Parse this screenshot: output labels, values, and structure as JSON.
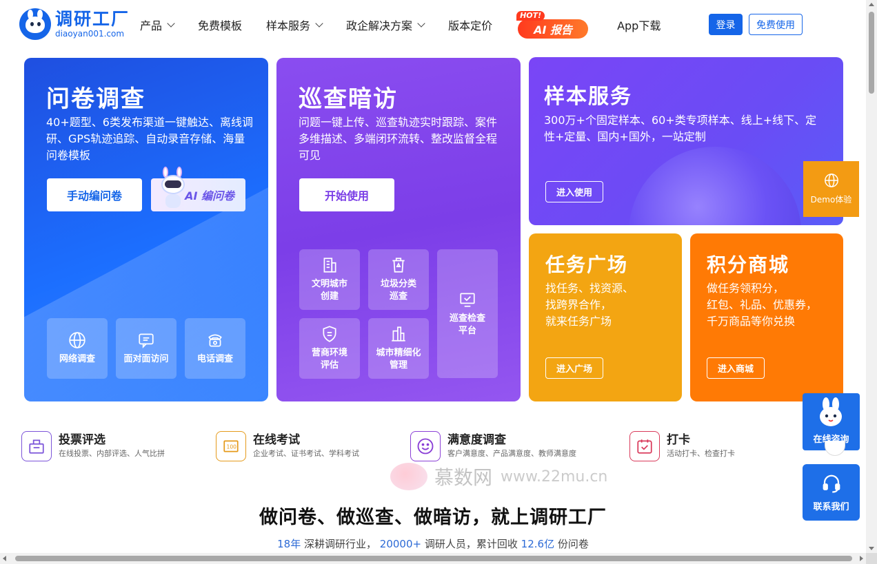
{
  "header": {
    "logo_title": "调研工厂",
    "logo_subtitle": "diaoyan001.com",
    "nav": [
      {
        "label": "产品",
        "has_dropdown": true
      },
      {
        "label": "免费模板",
        "has_dropdown": false
      },
      {
        "label": "样本服务",
        "has_dropdown": true
      },
      {
        "label": "政企解决方案",
        "has_dropdown": true
      },
      {
        "label": "版本定价",
        "has_dropdown": false
      }
    ],
    "ai_report_label": "AI 报告",
    "ai_report_badge": "HOT!",
    "app_download": "App下载",
    "login": "登录",
    "free_use": "免费使用"
  },
  "survey_card": {
    "title": "问卷调查",
    "desc": "40+题型、6类发布渠道一键触达、离线调研、GPS轨迹追踪、自动录音存储、海量问卷模板",
    "btn_manual": "手动编问卷",
    "btn_ai": "AI 编问卷",
    "tiles": [
      {
        "label": "网络调查",
        "icon": "globe-icon"
      },
      {
        "label": "面对面访问",
        "icon": "chat-icon"
      },
      {
        "label": "电话调查",
        "icon": "phone-icon"
      }
    ]
  },
  "inspection_card": {
    "title": "巡查暗访",
    "desc": "问题一键上传、巡查轨迹实时跟踪、案件多维描述、多端闭环流转、整改监督全程可见",
    "btn_start": "开始使用",
    "tiles": [
      {
        "label1": "文明城市",
        "label2": "创建",
        "icon": "building-icon"
      },
      {
        "label1": "垃圾分类",
        "label2": "巡查",
        "icon": "recycle-bin-icon"
      },
      {
        "label1": "巡查检查",
        "label2": "平台",
        "icon": "monitor-check-icon"
      },
      {
        "label1": "营商环境",
        "label2": "评估",
        "icon": "shield-icon"
      },
      {
        "label1": "城市精细化",
        "label2": "管理",
        "icon": "tower-icon"
      }
    ]
  },
  "sample_card": {
    "title": "样本服务",
    "desc": "300万+个固定样本、60+类专项样本、线上+线下、定性+定量、国内+国外，一站定制",
    "btn": "进入使用"
  },
  "task_card": {
    "title": "任务广场",
    "desc_lines": [
      "找任务、找资源、",
      "找跨界合作，",
      "就来任务广场"
    ],
    "btn": "进入广场",
    "color": "#f3a512"
  },
  "points_card": {
    "title": "积分商城",
    "desc_lines": [
      "做任务领积分，",
      "红包、礼品、优惠券，",
      "千万商品等你兑换"
    ],
    "btn": "进入商城",
    "color": "#ff7a05"
  },
  "features": [
    {
      "title": "投票评选",
      "sub": "在线投票、内部评选、人气比拼",
      "icon": "ballot-box-icon",
      "color": "#7b53d9"
    },
    {
      "title": "在线考试",
      "sub": "企业考试、证书考试、学科考试",
      "icon": "exam-paper-icon",
      "color": "#e59a1a"
    },
    {
      "title": "满意度调查",
      "sub": "客户满意度、产品满意度、教师满意度",
      "icon": "smile-icon",
      "color": "#8a3fd6"
    },
    {
      "title": "打卡",
      "sub": "活动打卡、检查打卡",
      "icon": "calendar-check-icon",
      "color": "#d9395a"
    }
  ],
  "watermark": {
    "name": "慕数网",
    "url": "www.22mu.cn"
  },
  "headline": "做问卷、做巡查、做暗访，就上调研工厂",
  "stats": {
    "n1": "18年",
    "t1": "深耕调研行业，",
    "n2": "20000+",
    "t2": "调研人员，累计回收",
    "n3": "12.6亿",
    "t3": "份问卷"
  },
  "floating": {
    "demo": "Demo体验",
    "consult": "在线咨询",
    "contact": "联系我们"
  }
}
